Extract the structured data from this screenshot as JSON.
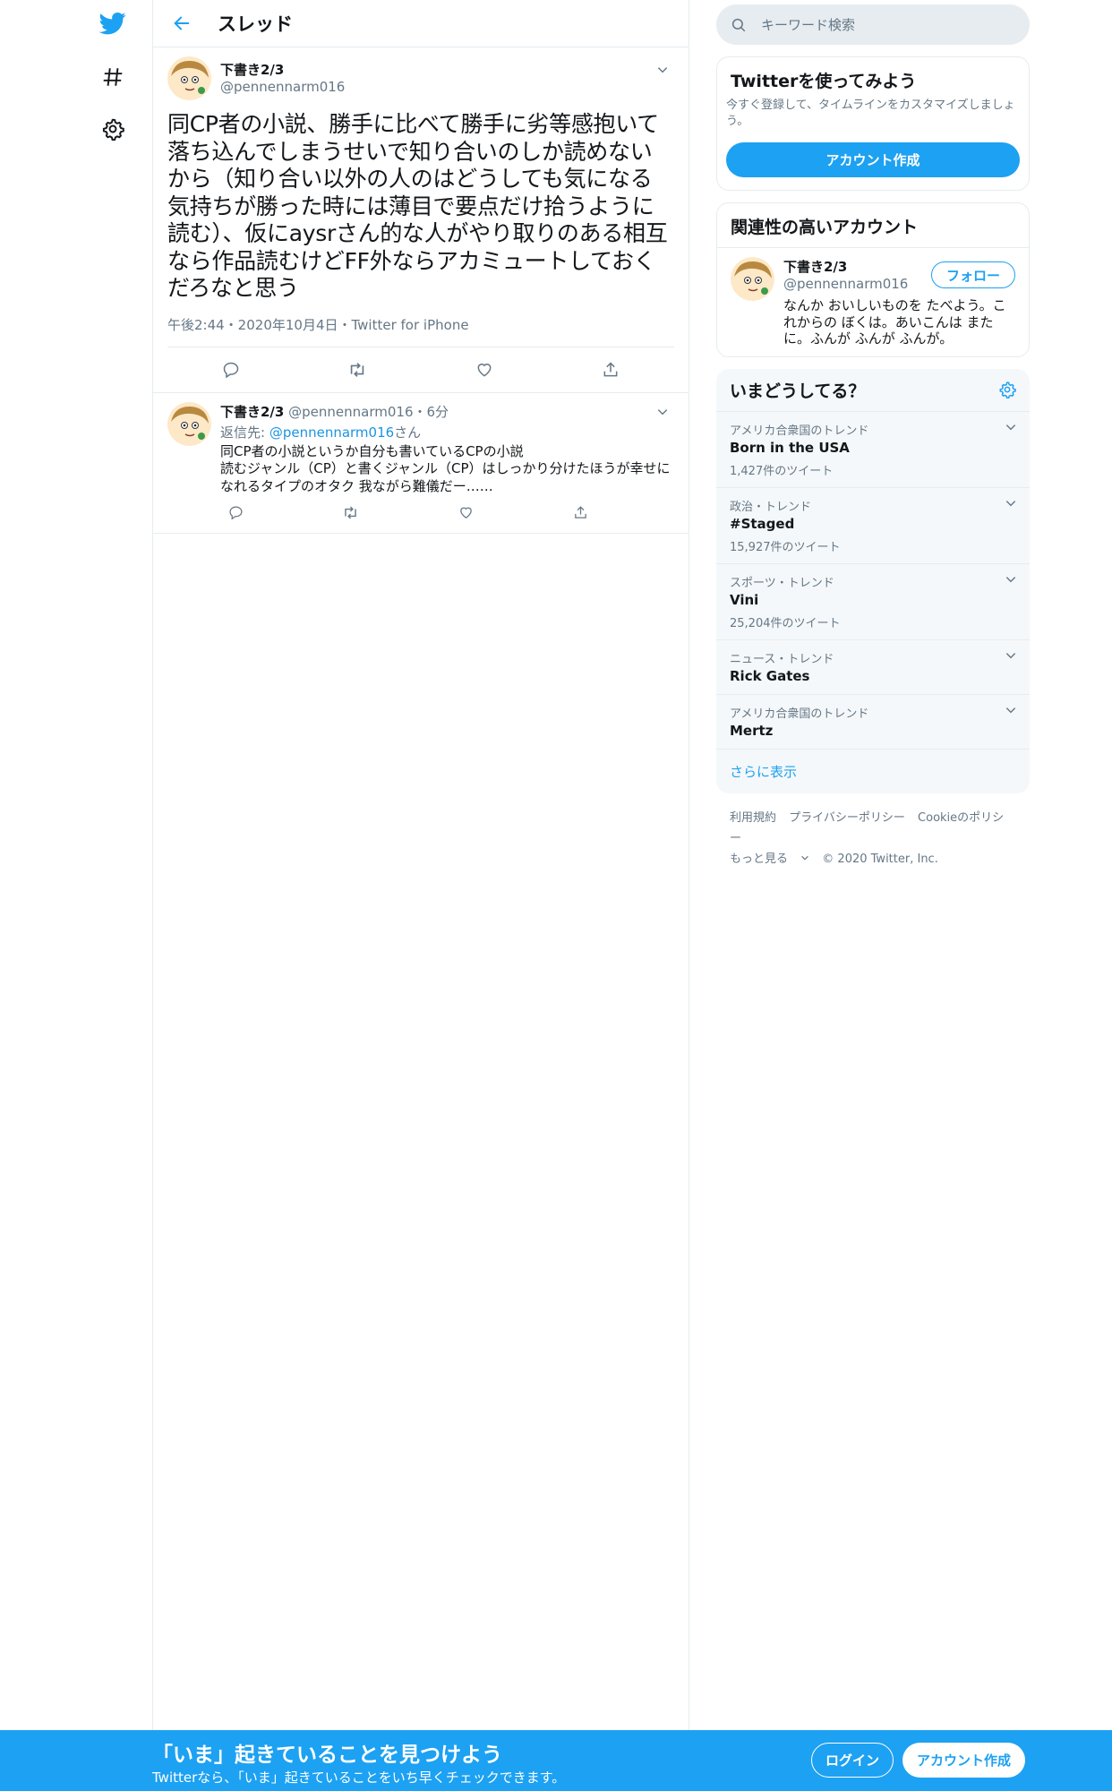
{
  "icons": {
    "logo": "twitter-bird-icon",
    "explore": "hashtag-icon",
    "settings": "gear-icon",
    "back": "back-arrow-icon",
    "search": "search-icon"
  },
  "colors": {
    "accent": "#1da1f2",
    "muted": "#657786",
    "border": "#e6ecf0"
  },
  "header": {
    "title": "スレッド"
  },
  "main_tweet": {
    "name": "下書き2/3",
    "handle": "@pennennarm016",
    "text": "同CP者の小説、勝手に比べて勝手に劣等感抱いて落ち込んでしまうせいで知り合いのしか読めないから（知り合い以外の人のはどうしても気になる気持ちが勝った時には薄目で要点だけ拾うように読む）、仮にaysrさん的な人がやり取りのある相互なら作品読むけどFF外ならアカミュートしておくだろなと思う",
    "meta": "午後2:44・2020年10月4日・Twitter for iPhone"
  },
  "reply_tweet": {
    "name": "下書き2/3",
    "handle": "@pennennarm016",
    "dot": "・",
    "time": "6分",
    "reply_to_prefix": "返信先: ",
    "reply_to_handle": "@pennennarm016",
    "reply_to_suffix": "さん",
    "text_lines": [
      "同CP者の小説というか自分も書いているCPの小説",
      "読むジャンル（CP）と書くジャンル（CP）はしっかり分けたほうが幸せになれるタイプのオタク 我ながら難儀だー……"
    ]
  },
  "search": {
    "placeholder": "キーワード検索"
  },
  "signup_card": {
    "title": "Twitterを使ってみよう",
    "subtitle": "今すぐ登録して、タイムラインをカスタマイズしましょう。",
    "button": "アカウント作成"
  },
  "related": {
    "title": "関連性の高いアカウント",
    "name": "下書き2/3",
    "handle": "@pennennarm016",
    "follow": "フォロー",
    "bio": "なんか おいしいものを たべよう。これからの ぼくは。あいこんは またに。ふんが ふんが ふんが。"
  },
  "trends": {
    "title": "いまどうしてる？",
    "items": [
      {
        "context": "アメリカ合衆国のトレンド",
        "name": "Born in the USA",
        "count": "1,427件のツイート"
      },
      {
        "context": "政治・トレンド",
        "name": "#Staged",
        "count": "15,927件のツイート"
      },
      {
        "context": "スポーツ・トレンド",
        "name": "Vini",
        "count": "25,204件のツイート"
      },
      {
        "context": "ニュース・トレンド",
        "name": "Rick Gates",
        "count": ""
      },
      {
        "context": "アメリカ合衆国のトレンド",
        "name": "Mertz",
        "count": ""
      }
    ],
    "more": "さらに表示"
  },
  "footer": {
    "terms": "利用規約",
    "privacy": "プライバシーポリシー",
    "cookie": "Cookieのポリシー",
    "more": "もっと見る",
    "copyright": "© 2020 Twitter, Inc."
  },
  "bottom_bar": {
    "title": "「いま」起きていることを見つけよう",
    "subtitle": "Twitterなら、「いま」起きていることをいち早くチェックできます。",
    "login": "ログイン",
    "signup": "アカウント作成"
  }
}
